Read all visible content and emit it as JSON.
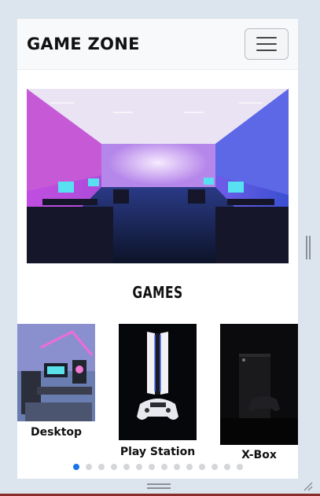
{
  "navbar": {
    "brand": "GAME ZONE",
    "toggle_icon": "hamburger-icon"
  },
  "hero": {
    "image": "gaming-lounge-photo"
  },
  "games_section": {
    "title": "GAMES",
    "cards": [
      {
        "label": "Desktop",
        "image": "desktop-setup-photo"
      },
      {
        "label": "Play Station",
        "image": "playstation-console-photo"
      },
      {
        "label": "X-Box",
        "image": "xbox-console-photo"
      }
    ],
    "carousel": {
      "dot_count": 14,
      "active_index": 0
    }
  },
  "colors": {
    "accent": "#1a73e8",
    "neon_pink": "#e04ad6",
    "neon_blue": "#3d6ff0"
  }
}
